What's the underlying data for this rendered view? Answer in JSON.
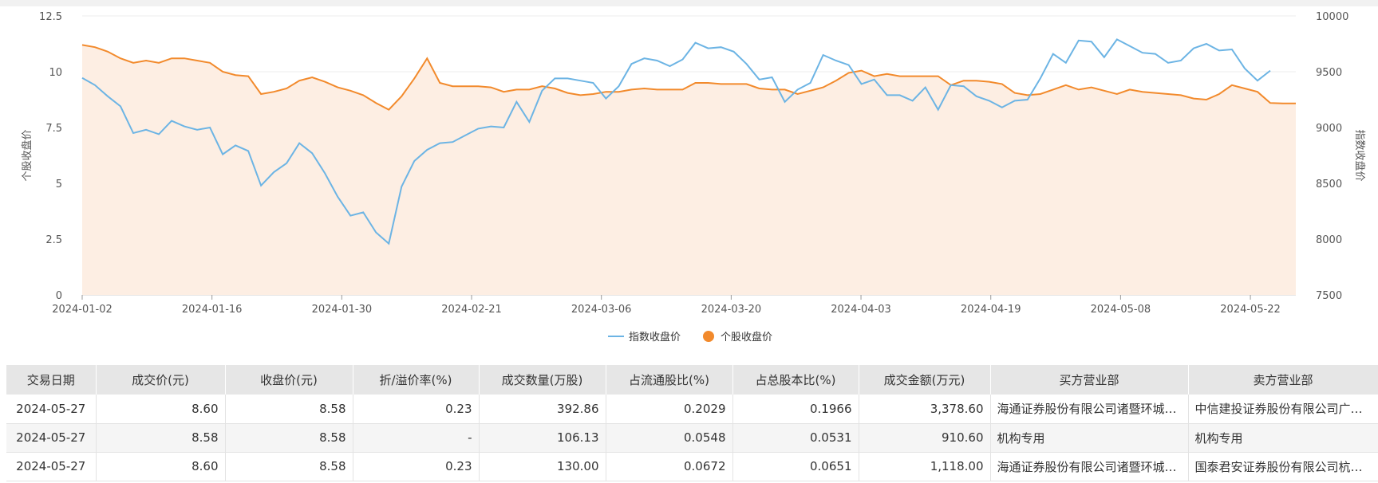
{
  "chart_data": {
    "type": "line",
    "y_left_label": "个股收盘价",
    "y_right_label": "指数收盘价",
    "y_left_ticks": [
      "0",
      "2.5",
      "5",
      "7.5",
      "10",
      "12.5"
    ],
    "y_right_ticks": [
      "7500",
      "8000",
      "8500",
      "9000",
      "9500",
      "10000"
    ],
    "ylim_left": [
      0,
      12.5
    ],
    "ylim_right": [
      7500,
      10000
    ],
    "x_ticks": [
      "2024-01-02",
      "2024-01-16",
      "2024-01-30",
      "2024-02-21",
      "2024-03-06",
      "2024-03-20",
      "2024-04-03",
      "2024-04-19",
      "2024-05-08",
      "2024-05-22"
    ],
    "legend": [
      "指数收盘价",
      "个股收盘价"
    ],
    "colors": {
      "index": "#6cb4e4",
      "stock": "#f28a2c",
      "fill": "#fdeee3"
    },
    "series": [
      {
        "name": "指数收盘价",
        "axis": "right",
        "values": [
          9445,
          9380,
          9280,
          9190,
          8950,
          8980,
          8940,
          9060,
          9010,
          8980,
          9000,
          8760,
          8840,
          8790,
          8480,
          8600,
          8680,
          8860,
          8770,
          8590,
          8380,
          8210,
          8240,
          8060,
          7960,
          8470,
          8700,
          8800,
          8860,
          8870,
          8930,
          8990,
          9010,
          9000,
          9230,
          9050,
          9330,
          9440,
          9440,
          9420,
          9400,
          9260,
          9370,
          9570,
          9620,
          9600,
          9550,
          9610,
          9760,
          9710,
          9720,
          9680,
          9570,
          9430,
          9450,
          9230,
          9340,
          9400,
          9650,
          9600,
          9560,
          9390,
          9430,
          9290,
          9290,
          9240,
          9360,
          9160,
          9380,
          9370,
          9280,
          9240,
          9180,
          9240,
          9250,
          9440,
          9660,
          9580,
          9780,
          9770,
          9630,
          9790,
          9730,
          9670,
          9660,
          9580,
          9600,
          9710,
          9750,
          9690,
          9700,
          9530,
          9420,
          9510
        ]
      },
      {
        "name": "个股收盘价",
        "axis": "left",
        "values": [
          11.2,
          11.1,
          10.9,
          10.6,
          10.4,
          10.5,
          10.4,
          10.6,
          10.6,
          10.5,
          10.4,
          10.0,
          9.85,
          9.8,
          9.0,
          9.1,
          9.25,
          9.6,
          9.75,
          9.55,
          9.3,
          9.15,
          8.95,
          8.6,
          8.3,
          8.9,
          9.7,
          10.6,
          9.5,
          9.35,
          9.35,
          9.35,
          9.3,
          9.1,
          9.2,
          9.2,
          9.35,
          9.25,
          9.05,
          8.95,
          9.0,
          9.1,
          9.1,
          9.2,
          9.25,
          9.2,
          9.2,
          9.2,
          9.5,
          9.5,
          9.45,
          9.45,
          9.45,
          9.25,
          9.2,
          9.2,
          9.0,
          9.15,
          9.3,
          9.6,
          9.95,
          10.05,
          9.8,
          9.9,
          9.8,
          9.8,
          9.8,
          9.8,
          9.4,
          9.6,
          9.6,
          9.55,
          9.45,
          9.05,
          8.95,
          9.0,
          9.2,
          9.4,
          9.2,
          9.3,
          9.15,
          9.0,
          9.2,
          9.1,
          9.05,
          9.0,
          8.95,
          8.8,
          8.75,
          9.0,
          9.4,
          9.25,
          9.1,
          8.6,
          8.58,
          8.58
        ]
      }
    ]
  },
  "table": {
    "headers": [
      "交易日期",
      "成交价(元)",
      "收盘价(元)",
      "折/溢价率(%)",
      "成交数量(万股)",
      "占流通股比(%)",
      "占总股本比(%)",
      "成交金额(万元)",
      "买方营业部",
      "卖方营业部"
    ],
    "rows": [
      [
        "2024-05-27",
        "8.60",
        "8.58",
        "0.23",
        "392.86",
        "0.2029",
        "0.1966",
        "3,378.60",
        "海通证券股份有限公司诸暨环城…",
        "中信建投证券股份有限公司广…"
      ],
      [
        "2024-05-27",
        "8.58",
        "8.58",
        "-",
        "106.13",
        "0.0548",
        "0.0531",
        "910.60",
        "机构专用",
        "机构专用"
      ],
      [
        "2024-05-27",
        "8.60",
        "8.58",
        "0.23",
        "130.00",
        "0.0672",
        "0.0651",
        "1,118.00",
        "海通证券股份有限公司诸暨环城…",
        "国泰君安证券股份有限公司杭…"
      ]
    ]
  }
}
